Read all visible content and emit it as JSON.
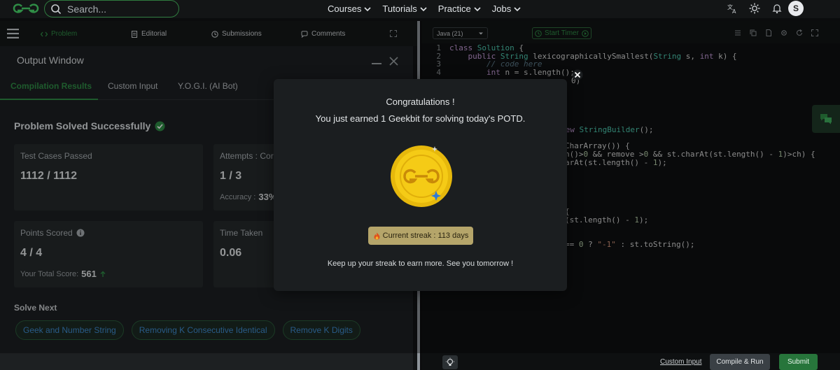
{
  "nav": {
    "search_placeholder": "Search...",
    "menu": [
      {
        "label": "Courses"
      },
      {
        "label": "Tutorials"
      },
      {
        "label": "Practice"
      },
      {
        "label": "Jobs"
      }
    ],
    "avatar_letter": "S",
    "icons": [
      "translate-icon",
      "theme-icon",
      "bell-icon"
    ]
  },
  "problem_tabs": [
    {
      "label": "Problem",
      "icon": "code-icon"
    },
    {
      "label": "Editorial",
      "icon": "doc-icon"
    },
    {
      "label": "Submissions",
      "icon": "clock-icon"
    },
    {
      "label": "Comments",
      "icon": "comment-icon"
    }
  ],
  "output": {
    "title": "Output Window",
    "tabs": [
      "Compilation Results",
      "Custom Input",
      "Y.O.G.I. (AI Bot)"
    ],
    "status": "Problem Solved Successfully",
    "cards": {
      "test_cases_label": "Test Cases Passed",
      "test_cases_value": "1112 / 1112",
      "attempts_label": "Attempts : Correct / Total",
      "attempts_value": "1 / 3",
      "accuracy_label": "Accuracy :",
      "accuracy_value": "33%",
      "points_label": "Points Scored",
      "points_value": "4 / 4",
      "total_score_label": "Your Total Score:",
      "total_score_value": "561",
      "time_label": "Time Taken",
      "time_value": "0.06"
    },
    "solve_next_label": "Solve Next",
    "solve_next": [
      "Geek and Number String",
      "Removing K Consecutive Identical",
      "Remove K Digits"
    ]
  },
  "editor": {
    "language": "Java (21)",
    "timer_label": "Start Timer",
    "line_numbers": [
      "1",
      "2",
      "3",
      "4"
    ],
    "custom_input_link": "Custom Input",
    "compile_run": "Compile & Run",
    "submit": "Submit"
  },
  "modal": {
    "title": "Congratulations !",
    "subtitle": "You just earned 1 Geekbit for solving today's POTD.",
    "streak": "Current streak : 113 days",
    "footer": "Keep up your streak to earn more. See you tomorrow !"
  },
  "colors": {
    "accent": "#2f8d46",
    "coin": "#f2c511",
    "streak_bg": "#b5a56a"
  }
}
